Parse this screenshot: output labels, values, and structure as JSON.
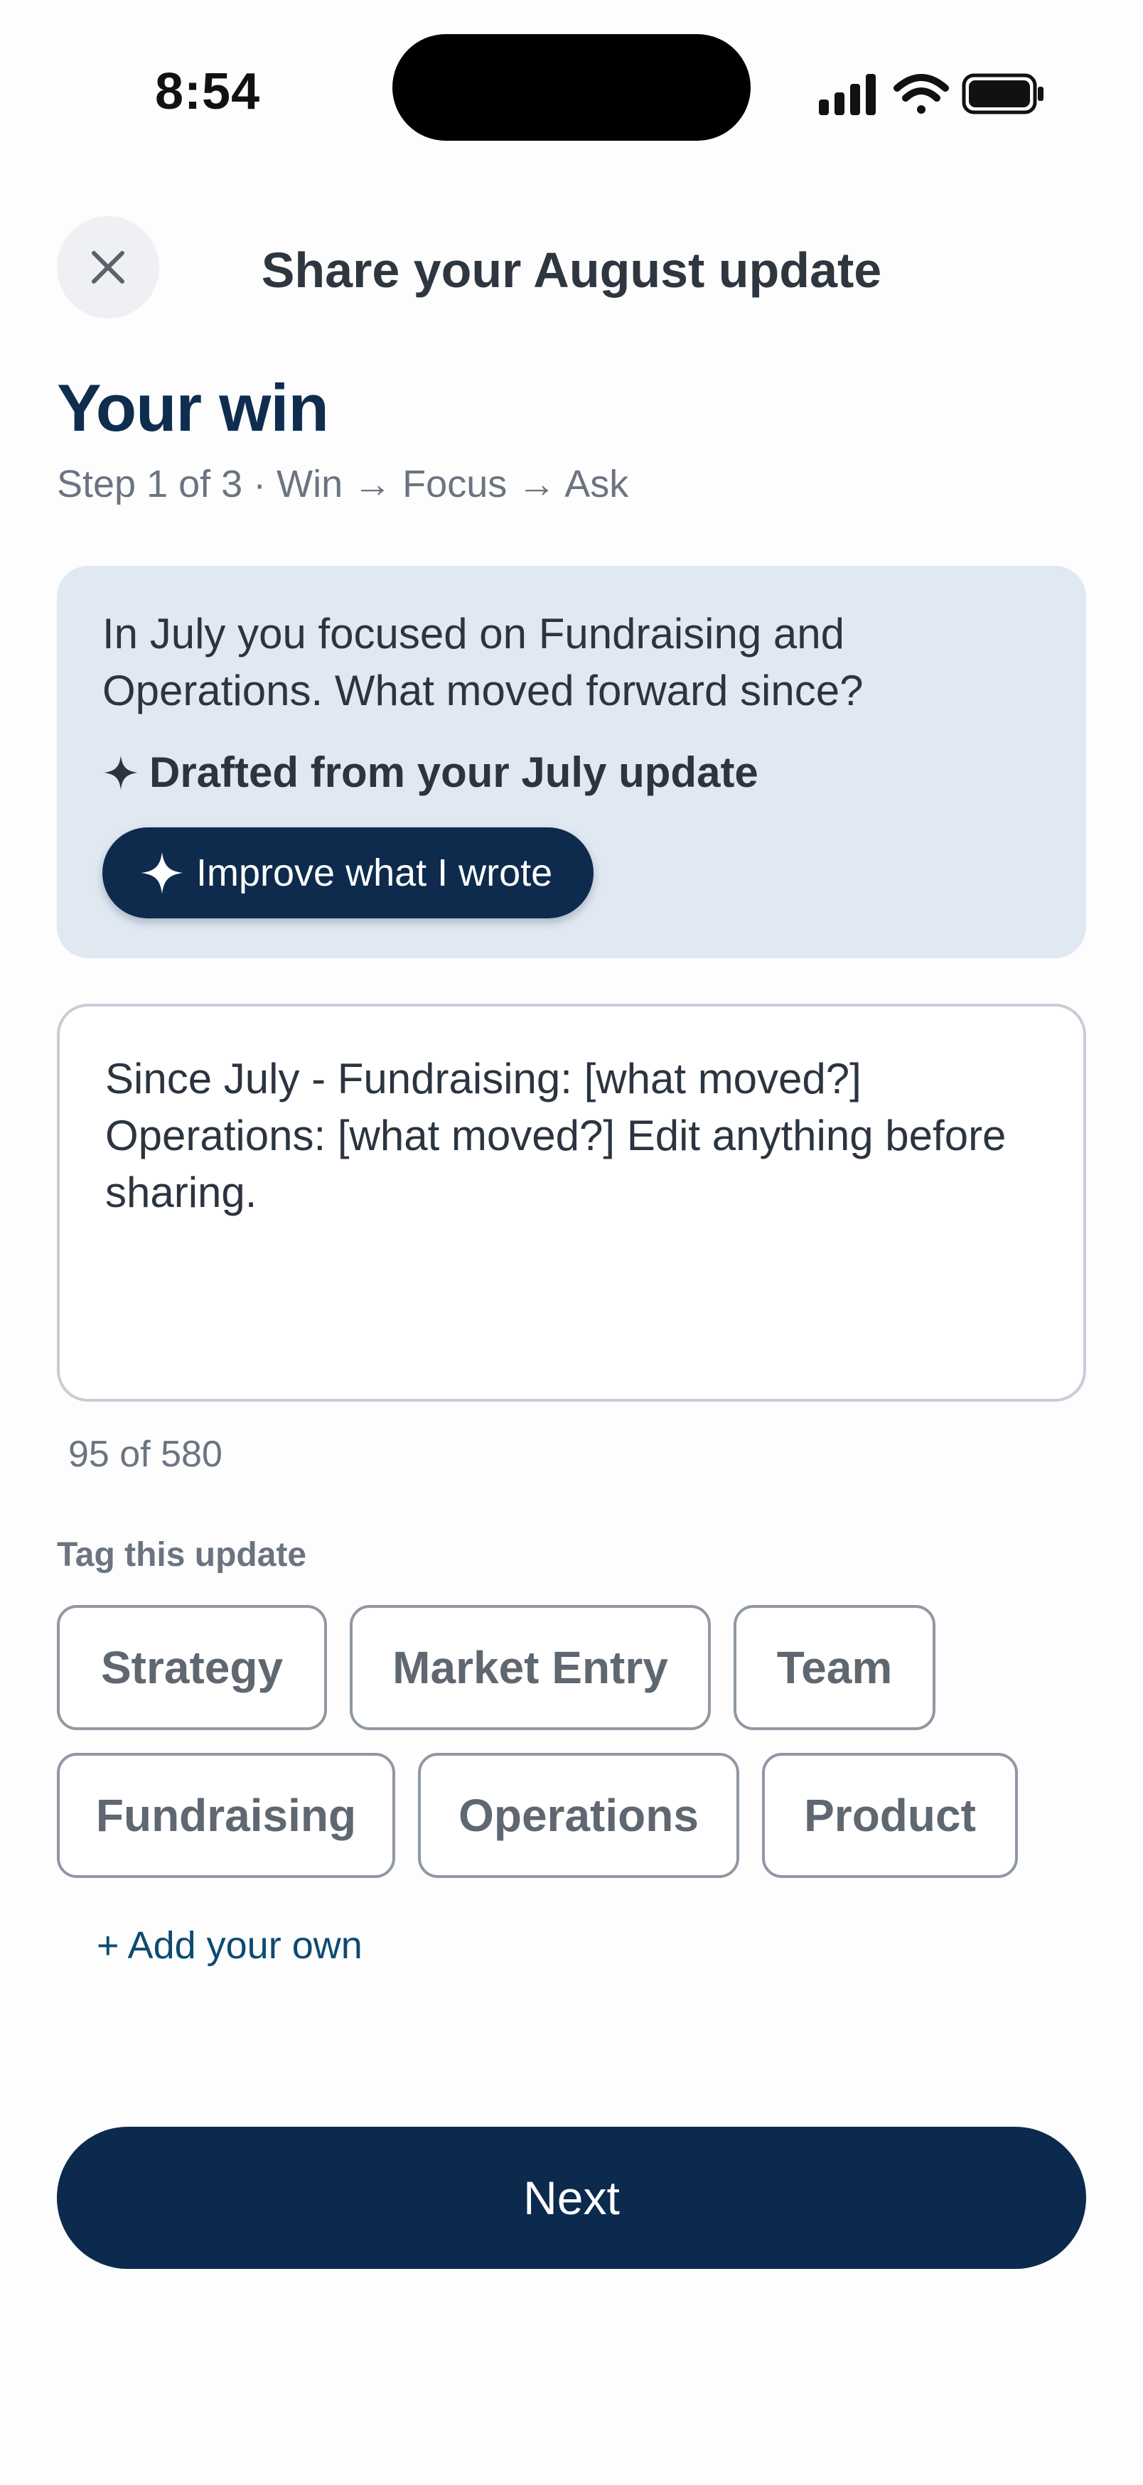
{
  "status_bar": {
    "time": "8:54"
  },
  "header": {
    "title": "Share your August update"
  },
  "page": {
    "title": "Your win",
    "step": "Step 1 of 3 · Win → Focus → Ask"
  },
  "prompt_card": {
    "text": "In July you focused on Fundraising and Operations. What moved forward since?",
    "drafted_label": "Drafted from your July update",
    "improve_button": "Improve what I wrote"
  },
  "update_field": {
    "value": "Since July - Fundraising: [what moved?] Operations: [what moved?] Edit anything before sharing.",
    "counter": "95 of 580"
  },
  "tags": {
    "label": "Tag this update",
    "items": [
      "Strategy",
      "Market Entry",
      "Team",
      "Fundraising",
      "Operations",
      "Product"
    ],
    "add_own": "+ Add your own"
  },
  "footer": {
    "next_button": "Next"
  },
  "colors": {
    "brand_navy": "#0b2a4e",
    "card_bg": "#e0e8f2",
    "link": "#0d4a73"
  }
}
